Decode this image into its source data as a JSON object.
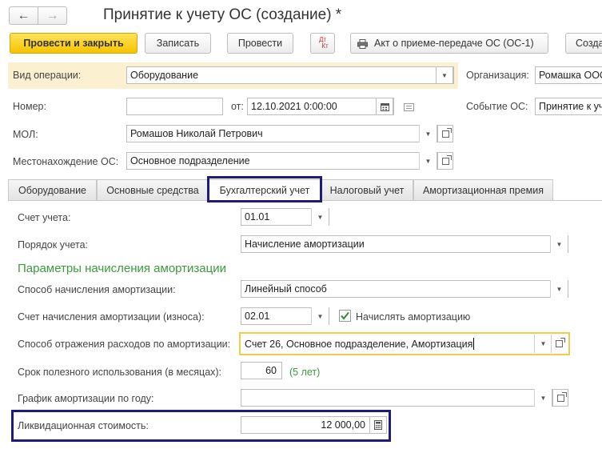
{
  "window": {
    "title": "Принятие к учету ОС (создание) *",
    "nav_back": "←",
    "nav_forward": "→"
  },
  "toolbar": {
    "post_close": "Провести и закрыть",
    "save": "Записать",
    "post": "Провести",
    "dtkt_top": "Дт",
    "dtkt_bottom": "Кт",
    "act": "Акт о приеме-передаче ОС (ОС-1)",
    "create_based": "Созда"
  },
  "header": {
    "operation_label": "Вид операции:",
    "operation_value": "Оборудование",
    "org_label": "Организация:",
    "org_value": "Ромашка ООО",
    "number_label": "Номер:",
    "number_value": "",
    "date_label": "от:",
    "date_value": "12.10.2021  0:00:00",
    "event_label": "Событие ОС:",
    "event_value": "Принятие к учету",
    "mol_label": "МОЛ:",
    "mol_value": "Ромашов Николай Петрович",
    "location_label": "Местонахождение ОС:",
    "location_value": "Основное подразделение"
  },
  "tabs": [
    {
      "label": "Оборудование"
    },
    {
      "label": "Основные средства"
    },
    {
      "label": "Бухгалтерский учет"
    },
    {
      "label": "Налоговый учет"
    },
    {
      "label": "Амортизационная премия"
    }
  ],
  "accounting": {
    "account_label": "Счет учета:",
    "account_value": "01.01",
    "order_label": "Порядок учета:",
    "order_value": "Начисление амортизации",
    "section_title": "Параметры начисления амортизации",
    "method_label": "Способ начисления амортизации:",
    "method_value": "Линейный способ",
    "depr_account_label": "Счет начисления амортизации (износа):",
    "depr_account_value": "02.01",
    "accrue_label": "Начислять амортизацию",
    "accrue_checked": true,
    "expense_label": "Способ отражения расходов по амортизации:",
    "expense_value": "Счет 26, Основное подразделение, Амортизация",
    "life_label": "Срок полезного использования (в месяцах):",
    "life_value": "60",
    "life_hint": "(5 лет)",
    "schedule_label": "График амортизации по году:",
    "schedule_value": "",
    "salvage_label": "Ликвидационная стоимость:",
    "salvage_value": "12 000,00"
  },
  "colors": {
    "accent_yellow": "#f5c400",
    "highlight_frame": "#1f1b7a",
    "section_green": "#3d9a3d",
    "hint_green": "#3d9a3d"
  }
}
